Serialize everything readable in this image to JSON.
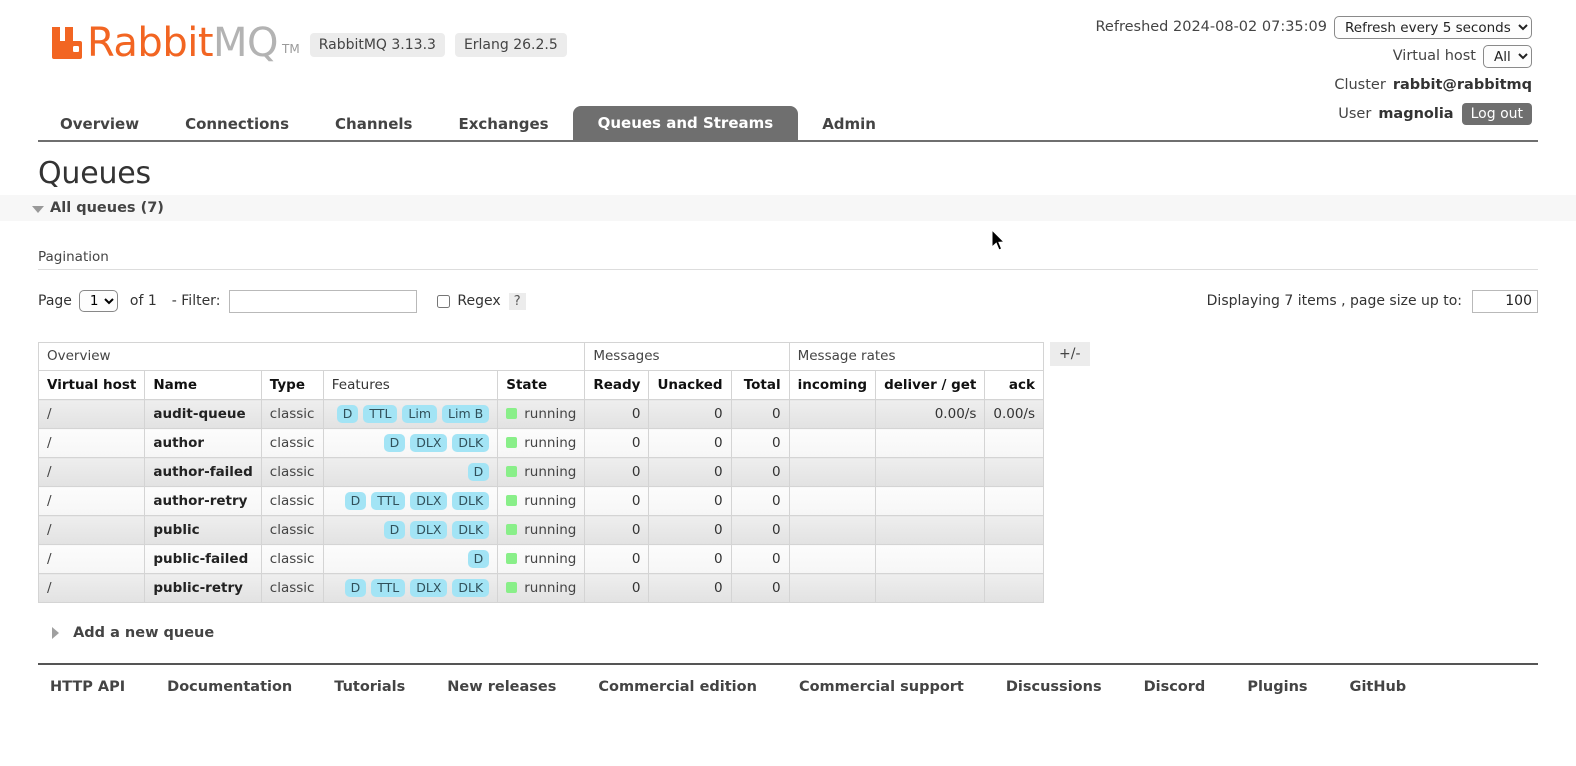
{
  "brand": {
    "name_primary": "Rabbit",
    "name_secondary": "MQ",
    "trademark": "TM",
    "version_pill": "RabbitMQ 3.13.3",
    "erlang_pill": "Erlang 26.2.5"
  },
  "header": {
    "refreshed_label": "Refreshed 2024-08-02 07:35:09",
    "refresh_select_value": "Refresh every 5 seconds",
    "refresh_options": [
      "Refresh every 5 seconds"
    ],
    "vhost_label": "Virtual host",
    "vhost_value": "All",
    "vhost_options": [
      "All"
    ],
    "cluster_label": "Cluster",
    "cluster_value": "rabbit@rabbitmq",
    "user_label": "User",
    "user_value": "magnolia",
    "logout_label": "Log out"
  },
  "nav": {
    "items": [
      {
        "label": "Overview",
        "active": false
      },
      {
        "label": "Connections",
        "active": false
      },
      {
        "label": "Channels",
        "active": false
      },
      {
        "label": "Exchanges",
        "active": false
      },
      {
        "label": "Queues and Streams",
        "active": true
      },
      {
        "label": "Admin",
        "active": false
      }
    ]
  },
  "page": {
    "title": "Queues",
    "all_queues_label": "All queues (7)",
    "pagination_label": "Pagination",
    "add_queue_label": "Add a new queue"
  },
  "pagination": {
    "page_label": "Page",
    "page_value": "1",
    "page_options": [
      "1"
    ],
    "of_label": "of 1",
    "filter_label": "- Filter:",
    "filter_value": "",
    "filter_placeholder": "",
    "regex_label": "Regex",
    "regex_checked": false,
    "help_label": "?",
    "displaying_label": "Displaying 7 items , page size up to:",
    "page_size_value": "100"
  },
  "table": {
    "group_headers": [
      {
        "label": "Overview",
        "span": 5
      },
      {
        "label": "Messages",
        "span": 3
      },
      {
        "label": "Message rates",
        "span": 3
      }
    ],
    "columns": [
      {
        "label": "Virtual host",
        "sortable": true,
        "align": "left"
      },
      {
        "label": "Name",
        "sortable": true,
        "align": "left"
      },
      {
        "label": "Type",
        "sortable": true,
        "align": "left"
      },
      {
        "label": "Features",
        "sortable": false,
        "align": "left"
      },
      {
        "label": "State",
        "sortable": true,
        "align": "left"
      },
      {
        "label": "Ready",
        "sortable": true,
        "align": "right"
      },
      {
        "label": "Unacked",
        "sortable": true,
        "align": "right"
      },
      {
        "label": "Total",
        "sortable": true,
        "align": "right"
      },
      {
        "label": "incoming",
        "sortable": true,
        "align": "right"
      },
      {
        "label": "deliver / get",
        "sortable": true,
        "align": "right"
      },
      {
        "label": "ack",
        "sortable": true,
        "align": "right"
      }
    ],
    "toggle_columns_label": "+/-",
    "rows": [
      {
        "vhost": "/",
        "name": "audit-queue",
        "type": "classic",
        "features": [
          "D",
          "TTL",
          "Lim",
          "Lim B"
        ],
        "state": "running",
        "state_color": "#89ef89",
        "ready": "0",
        "unacked": "0",
        "total": "0",
        "incoming": "",
        "deliver_get": "0.00/s",
        "ack": "0.00/s"
      },
      {
        "vhost": "/",
        "name": "author",
        "type": "classic",
        "features": [
          "D",
          "DLX",
          "DLK"
        ],
        "state": "running",
        "state_color": "#89ef89",
        "ready": "0",
        "unacked": "0",
        "total": "0",
        "incoming": "",
        "deliver_get": "",
        "ack": ""
      },
      {
        "vhost": "/",
        "name": "author-failed",
        "type": "classic",
        "features": [
          "D"
        ],
        "state": "running",
        "state_color": "#89ef89",
        "ready": "0",
        "unacked": "0",
        "total": "0",
        "incoming": "",
        "deliver_get": "",
        "ack": ""
      },
      {
        "vhost": "/",
        "name": "author-retry",
        "type": "classic",
        "features": [
          "D",
          "TTL",
          "DLX",
          "DLK"
        ],
        "state": "running",
        "state_color": "#89ef89",
        "ready": "0",
        "unacked": "0",
        "total": "0",
        "incoming": "",
        "deliver_get": "",
        "ack": ""
      },
      {
        "vhost": "/",
        "name": "public",
        "type": "classic",
        "features": [
          "D",
          "DLX",
          "DLK"
        ],
        "state": "running",
        "state_color": "#89ef89",
        "ready": "0",
        "unacked": "0",
        "total": "0",
        "incoming": "",
        "deliver_get": "",
        "ack": ""
      },
      {
        "vhost": "/",
        "name": "public-failed",
        "type": "classic",
        "features": [
          "D"
        ],
        "state": "running",
        "state_color": "#89ef89",
        "ready": "0",
        "unacked": "0",
        "total": "0",
        "incoming": "",
        "deliver_get": "",
        "ack": ""
      },
      {
        "vhost": "/",
        "name": "public-retry",
        "type": "classic",
        "features": [
          "D",
          "TTL",
          "DLX",
          "DLK"
        ],
        "state": "running",
        "state_color": "#89ef89",
        "ready": "0",
        "unacked": "0",
        "total": "0",
        "incoming": "",
        "deliver_get": "",
        "ack": ""
      }
    ]
  },
  "footer": {
    "links": [
      "HTTP API",
      "Documentation",
      "Tutorials",
      "New releases",
      "Commercial edition",
      "Commercial support",
      "Discussions",
      "Discord",
      "Plugins",
      "GitHub"
    ]
  },
  "colors": {
    "brand_orange": "#f26522",
    "nav_active_bg": "#6f6f6f",
    "badge_bg": "#a3e4f5",
    "running_green": "#89ef89"
  }
}
